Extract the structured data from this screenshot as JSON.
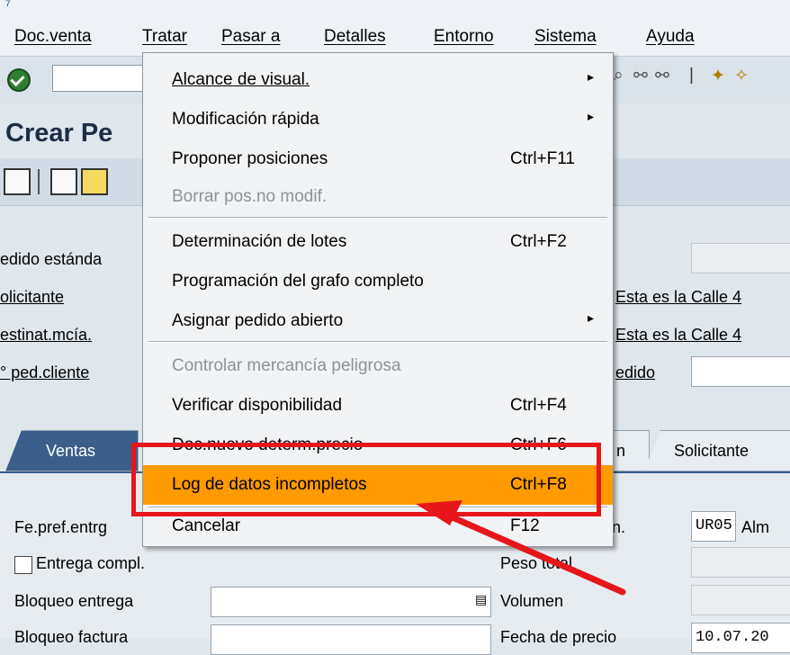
{
  "menubar": {
    "items": [
      "Doc.venta",
      "Tratar",
      "Pasar a",
      "Detalles",
      "Entorno",
      "Sistema",
      "Ayuda"
    ]
  },
  "page": {
    "title": "Crear Pe"
  },
  "header_fields": {
    "pedido_estandar": "edido estánda",
    "solicitante": "olicitante",
    "destinat": "estinat.mcía.",
    "ped_cliente": "° ped.cliente",
    "addr1": "Esta es la Calle 4",
    "addr2": "Esta es la Calle 4",
    "fe_pedido": "edido"
  },
  "tabs": {
    "ventas": "Ventas",
    "partial": "n",
    "solicitante": "Solicitante"
  },
  "panel": {
    "fe_pref": "Fe.pref.entrg",
    "entrega_compl": "Entrega compl.",
    "bloqueo_entrega": "Bloqueo entrega",
    "bloqueo_factura": "Bloqueo factura",
    "alm_prefix": "in.",
    "alm_value": "UR05",
    "alm_label": "Alm",
    "peso_total": "Peso total",
    "volumen": "Volumen",
    "fecha_precio": "Fecha de precio",
    "fecha_value": "10.07.20"
  },
  "menu": {
    "items": [
      {
        "label": "Alcance de visual.",
        "shortcut": "",
        "submenu": true,
        "disabled": false
      },
      {
        "label": "Modificación rápida",
        "shortcut": "",
        "submenu": true,
        "disabled": false
      },
      {
        "label": "Proponer posiciones",
        "shortcut": "Ctrl+F11",
        "submenu": false,
        "disabled": false
      },
      {
        "label": "Borrar pos.no modif.",
        "shortcut": "",
        "submenu": false,
        "disabled": true
      },
      {
        "label": "Determinación de lotes",
        "shortcut": "Ctrl+F2",
        "submenu": false,
        "disabled": false
      },
      {
        "label": "Programación del grafo completo",
        "shortcut": "",
        "submenu": false,
        "disabled": false
      },
      {
        "label": "Asignar pedido abierto",
        "shortcut": "",
        "submenu": true,
        "disabled": false
      },
      {
        "label": "Controlar mercancía peligrosa",
        "shortcut": "",
        "submenu": false,
        "disabled": true
      },
      {
        "label": "Verificar disponibilidad",
        "shortcut": "Ctrl+F4",
        "submenu": false,
        "disabled": false
      },
      {
        "label": "Doc.nuevo determ.precio",
        "shortcut": "Ctrl+F6",
        "submenu": false,
        "disabled": false
      },
      {
        "label": "Log de datos incompletos",
        "shortcut": "Ctrl+F8",
        "submenu": false,
        "disabled": false,
        "highlighted": true
      },
      {
        "label": "Cancelar",
        "shortcut": "F12",
        "submenu": false,
        "disabled": false
      }
    ]
  },
  "colors": {
    "highlight": "#ff9a00",
    "annotation": "#e6161b"
  }
}
